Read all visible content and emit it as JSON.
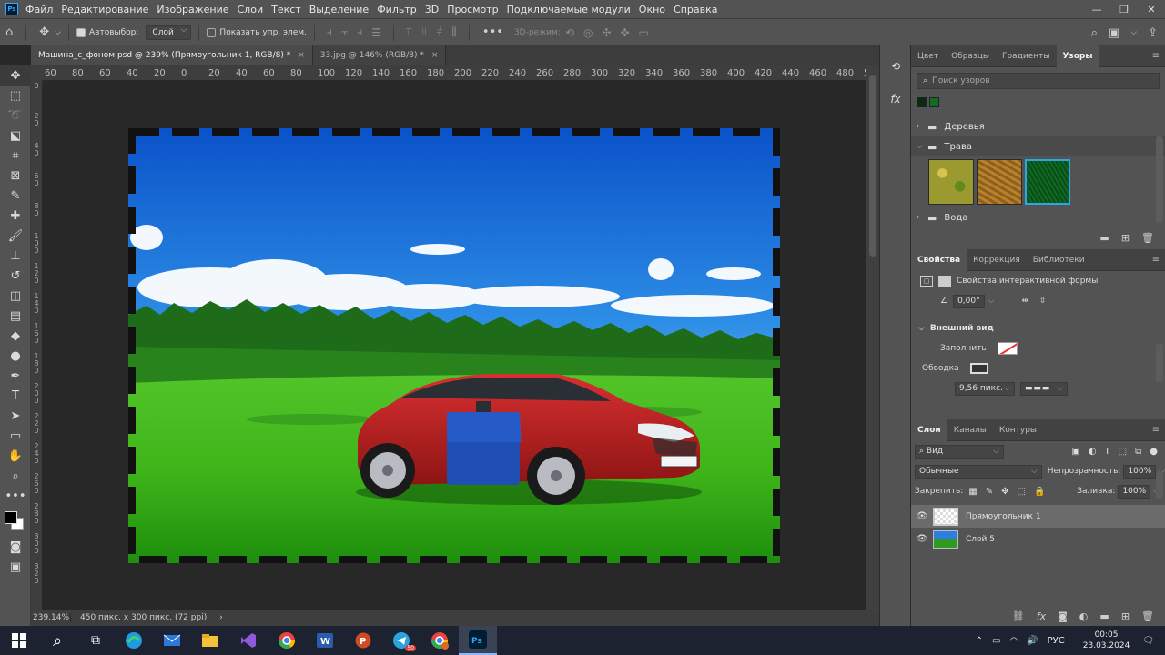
{
  "app": {
    "logo": "Ps",
    "menu": [
      "Файл",
      "Редактирование",
      "Изображение",
      "Слои",
      "Текст",
      "Выделение",
      "Фильтр",
      "3D",
      "Просмотр",
      "Подключаемые модули",
      "Окно",
      "Справка"
    ]
  },
  "options_bar": {
    "autoselect_label": "Автовыбор:",
    "autoselect_value": "Слой",
    "show_controls_label": "Показать упр. элем.",
    "mode_3d_label": "3D-режим:"
  },
  "tabs": [
    {
      "label": "Машина_с_фоном.psd @ 239% (Прямоугольник 1, RGB/8) *",
      "close": "×"
    },
    {
      "label": "33.jpg @ 146% (RGB/8) *",
      "close": "×"
    }
  ],
  "ruler_h": [
    "60",
    "80",
    "60",
    "40",
    "20",
    "0",
    "20",
    "40",
    "60",
    "80",
    "100",
    "120",
    "140",
    "160",
    "180",
    "200",
    "220",
    "240",
    "260",
    "280",
    "300",
    "320",
    "340",
    "360",
    "380",
    "400",
    "420",
    "440",
    "460",
    "480",
    "500"
  ],
  "ruler_v": [
    "0",
    "2 0",
    "4 0",
    "6 0",
    "8 0",
    "1 0 0",
    "1 2 0",
    "1 4 0",
    "1 6 0",
    "1 8 0",
    "2 0 0",
    "2 2 0",
    "2 4 0",
    "2 6 0",
    "2 8 0",
    "3 0 0",
    "3 2 0"
  ],
  "status": {
    "zoom": "239,14%",
    "info": "450 пикс. x 300 пикс. (72 ppi)",
    "arrow": "›"
  },
  "patterns_panel": {
    "tabs": [
      "Цвет",
      "Образцы",
      "Градиенты",
      "Узоры"
    ],
    "search_placeholder": "Поиск узоров",
    "folders": {
      "trees": "Деревья",
      "grass": "Трава",
      "water": "Вода"
    },
    "colors": {
      "recent1": "#0a2a12",
      "recent2": "#0f6e25"
    }
  },
  "properties_panel": {
    "tabs": [
      "Свойства",
      "Коррекция",
      "Библиотеки"
    ],
    "shape_props": "Свойства интерактивной формы",
    "angle": "0,00°",
    "appearance_title": "Внешний вид",
    "fill_label": "Заполнить",
    "stroke_label": "Обводка",
    "stroke_width": "9,56 пикс."
  },
  "layers_panel": {
    "tabs": [
      "Слои",
      "Каналы",
      "Контуры"
    ],
    "filter_kind": "Вид",
    "blend_mode": "Обычные",
    "opacity_label": "Непрозрачность:",
    "opacity_value": "100%",
    "lock_label": "Закрепить:",
    "fill_label": "Заливка:",
    "fill_value": "100%",
    "layers": [
      {
        "name": "Прямоугольник 1"
      },
      {
        "name": "Слой 5"
      }
    ]
  },
  "taskbar": {
    "lang": "РУС",
    "time": "00:05",
    "date": "23.03.2024",
    "telegram_badge": "50"
  }
}
